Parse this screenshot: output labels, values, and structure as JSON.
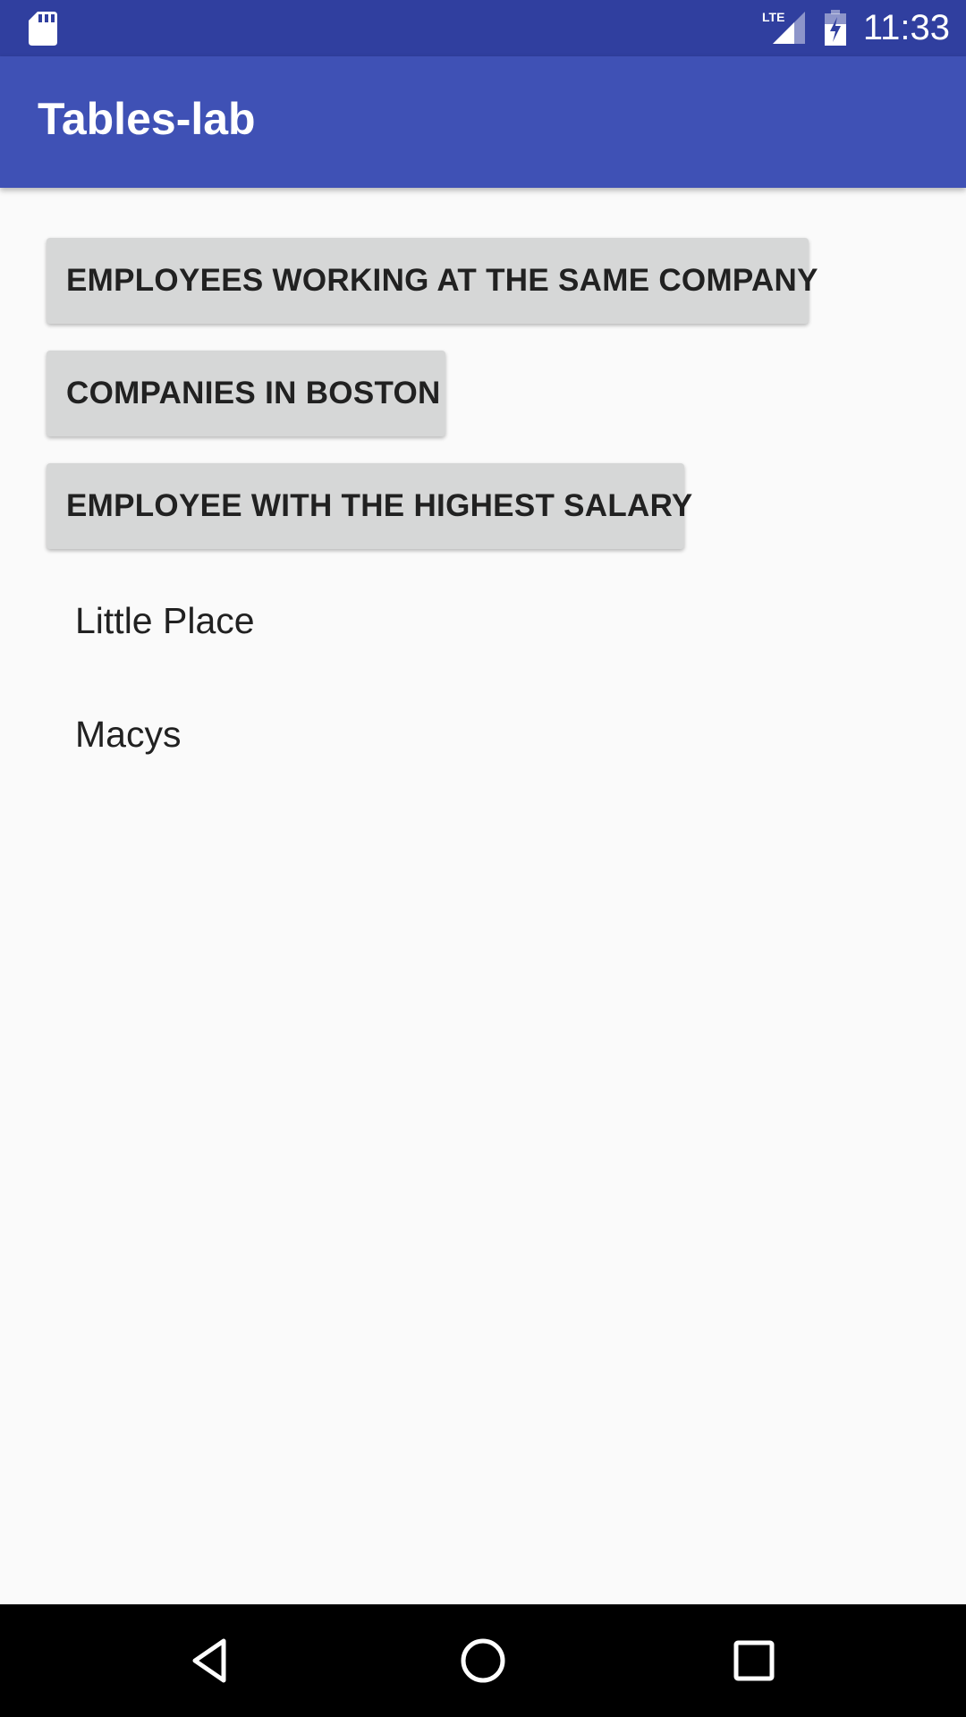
{
  "status_bar": {
    "time": "11:33",
    "network": "LTE",
    "icons": [
      "sd-card-icon",
      "lte-signal-icon",
      "battery-charging-icon"
    ]
  },
  "app_bar": {
    "title": "Tables-lab"
  },
  "buttons": [
    {
      "label": "EMPLOYEES WORKING AT THE SAME COMPANY"
    },
    {
      "label": "COMPANIES IN BOSTON"
    },
    {
      "label": "EMPLOYEE WITH THE HIGHEST SALARY"
    }
  ],
  "results": [
    {
      "text": "Little Place"
    },
    {
      "text": "Macys"
    }
  ],
  "nav_bar": {
    "icons": [
      "back-icon",
      "home-icon",
      "recents-icon"
    ]
  },
  "colors": {
    "status_bar": "#303f9f",
    "app_bar": "#3f51b5",
    "background": "#fafafa",
    "button": "#d6d7d7",
    "text": "#212121"
  }
}
